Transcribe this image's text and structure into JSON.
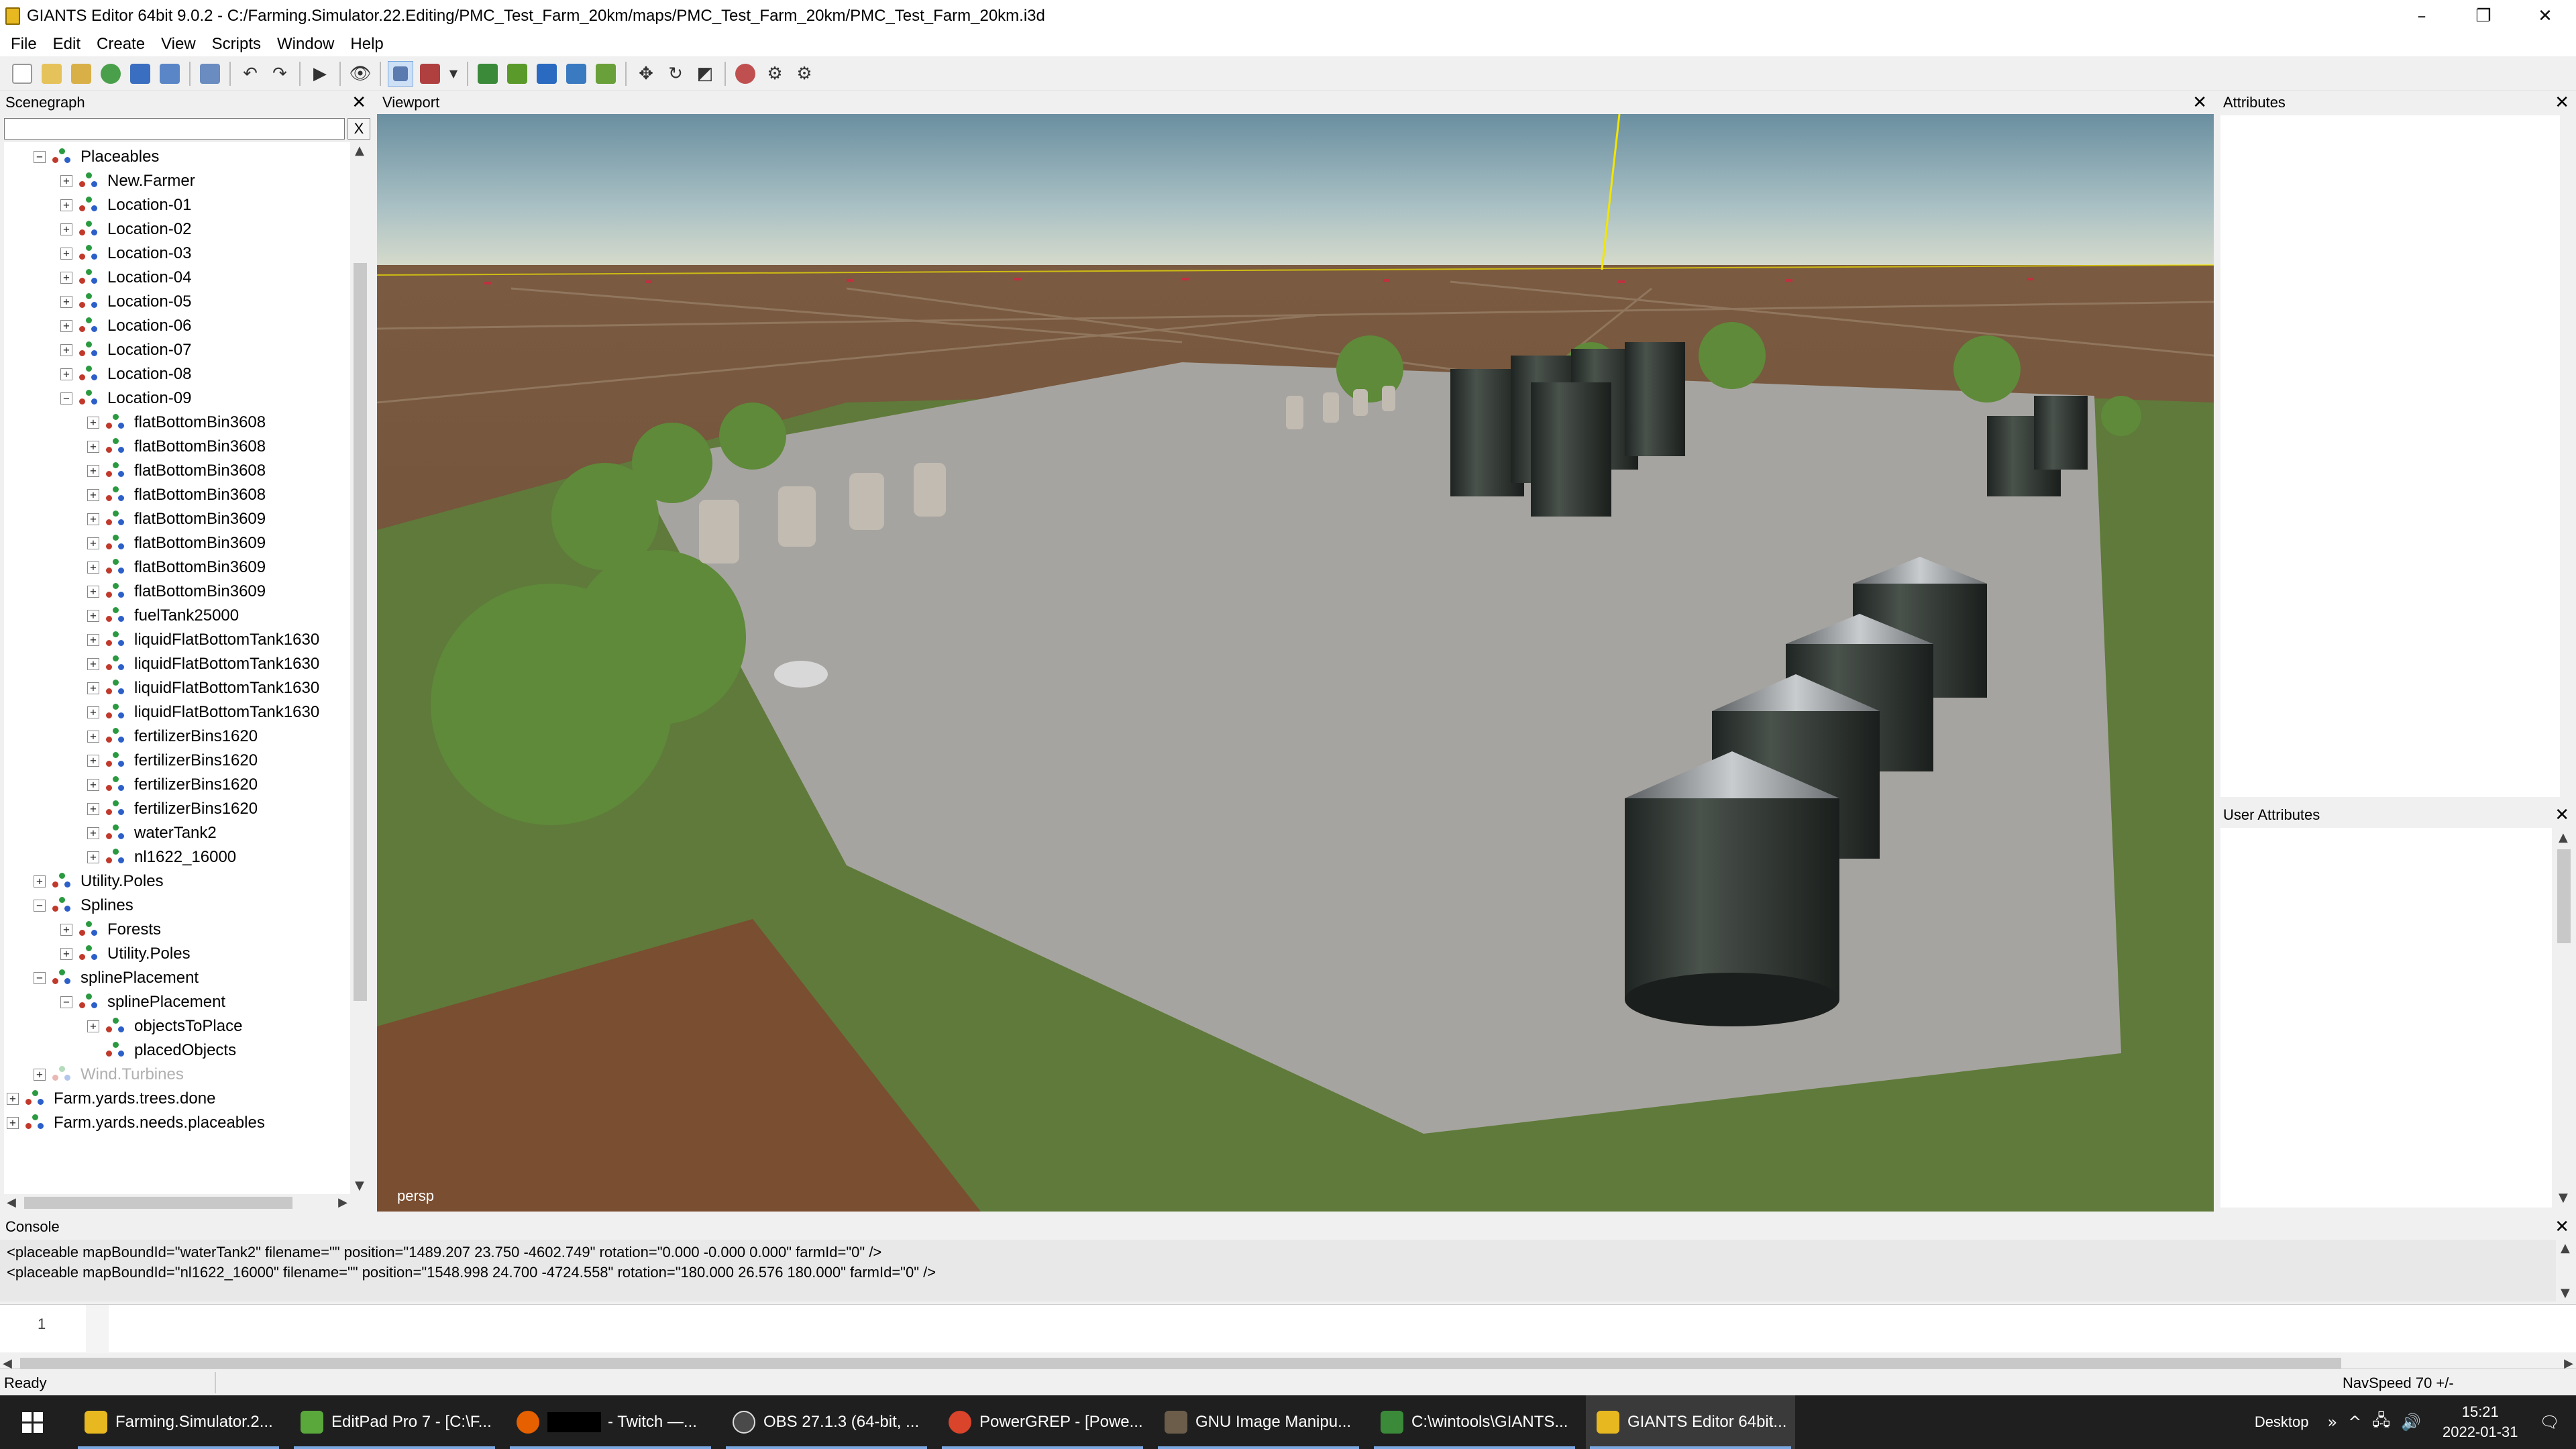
{
  "window": {
    "title": "GIANTS Editor 64bit 9.0.2 - C:/Farming.Simulator.22.Editing/PMC_Test_Farm_20km/maps/PMC_Test_Farm_20km/PMC_Test_Farm_20km.i3d",
    "minimize": "–",
    "restore": "❐",
    "close": "✕"
  },
  "menu": [
    "File",
    "Edit",
    "Create",
    "View",
    "Scripts",
    "Window",
    "Help"
  ],
  "panels": {
    "scenegraph": "Scenegraph",
    "viewport": "Viewport",
    "attributes": "Attributes",
    "user_attributes": "User Attributes",
    "console": "Console",
    "close_glyph": "✕"
  },
  "scenegraph": {
    "search_value": "",
    "clear_label": "X",
    "nodes": [
      {
        "label": "Placeables",
        "expanded": true,
        "dim": false
      },
      {
        "label": "New.Farmer",
        "expanded": false,
        "dim": false
      },
      {
        "label": "Location-01",
        "expanded": false,
        "dim": false
      },
      {
        "label": "Location-02",
        "expanded": false,
        "dim": false
      },
      {
        "label": "Location-03",
        "expanded": false,
        "dim": false
      },
      {
        "label": "Location-04",
        "expanded": false,
        "dim": false
      },
      {
        "label": "Location-05",
        "expanded": false,
        "dim": false
      },
      {
        "label": "Location-06",
        "expanded": false,
        "dim": false
      },
      {
        "label": "Location-07",
        "expanded": false,
        "dim": false
      },
      {
        "label": "Location-08",
        "expanded": false,
        "dim": false
      },
      {
        "label": "Location-09",
        "expanded": true,
        "dim": false
      },
      {
        "label": "flatBottomBin3608",
        "expanded": false,
        "dim": false
      },
      {
        "label": "flatBottomBin3608",
        "expanded": false,
        "dim": false
      },
      {
        "label": "flatBottomBin3608",
        "expanded": false,
        "dim": false
      },
      {
        "label": "flatBottomBin3608",
        "expanded": false,
        "dim": false
      },
      {
        "label": "flatBottomBin3609",
        "expanded": false,
        "dim": false
      },
      {
        "label": "flatBottomBin3609",
        "expanded": false,
        "dim": false
      },
      {
        "label": "flatBottomBin3609",
        "expanded": false,
        "dim": false
      },
      {
        "label": "flatBottomBin3609",
        "expanded": false,
        "dim": false
      },
      {
        "label": "fuelTank25000",
        "expanded": false,
        "dim": false
      },
      {
        "label": "liquidFlatBottomTank1630",
        "expanded": false,
        "dim": false
      },
      {
        "label": "liquidFlatBottomTank1630",
        "expanded": false,
        "dim": false
      },
      {
        "label": "liquidFlatBottomTank1630",
        "expanded": false,
        "dim": false
      },
      {
        "label": "liquidFlatBottomTank1630",
        "expanded": false,
        "dim": false
      },
      {
        "label": "fertilizerBins1620",
        "expanded": false,
        "dim": false
      },
      {
        "label": "fertilizerBins1620",
        "expanded": false,
        "dim": false
      },
      {
        "label": "fertilizerBins1620",
        "expanded": false,
        "dim": false
      },
      {
        "label": "fertilizerBins1620",
        "expanded": false,
        "dim": false
      },
      {
        "label": "waterTank2",
        "expanded": false,
        "dim": false
      },
      {
        "label": "nl1622_16000",
        "expanded": false,
        "dim": false
      },
      {
        "label": "Utility.Poles",
        "expanded": false,
        "dim": false
      },
      {
        "label": "Splines",
        "expanded": true,
        "dim": false
      },
      {
        "label": "Forests",
        "expanded": false,
        "dim": false
      },
      {
        "label": "Utility.Poles",
        "expanded": false,
        "dim": false
      },
      {
        "label": "splinePlacement",
        "expanded": true,
        "dim": false
      },
      {
        "label": "splinePlacement",
        "expanded": true,
        "dim": false
      },
      {
        "label": "objectsToPlace",
        "expanded": false,
        "dim": false
      },
      {
        "label": "placedObjects",
        "expanded": null,
        "dim": false
      },
      {
        "label": "Wind.Turbines",
        "expanded": false,
        "dim": true
      },
      {
        "label": "Farm.yards.trees.done",
        "expanded": false,
        "dim": false
      },
      {
        "label": "Farm.yards.needs.placeables",
        "expanded": false,
        "dim": false
      }
    ]
  },
  "viewport": {
    "camera": "persp"
  },
  "console": {
    "lines": [
      "<placeable mapBoundId=\"waterTank2\" filename=\"\" position=\"1489.207 23.750 -4602.749\" rotation=\"0.000 -0.000 0.000\" farmId=\"0\" />",
      "<placeable mapBoundId=\"nl1622_16000\" filename=\"\" position=\"1548.998 24.700 -4724.558\" rotation=\"180.000 26.576 180.000\" farmId=\"0\" />"
    ],
    "line_number": "1",
    "input_value": ""
  },
  "status": {
    "left": "Ready",
    "right": "NavSpeed 70 +/-"
  },
  "taskbar": {
    "tasks": [
      {
        "label": "Farming.Simulator.2...",
        "color": "#e8b820"
      },
      {
        "label": "EditPad Pro 7 - [C:\\F...",
        "color": "#5aa83c"
      },
      {
        "label": "- Twitch —...",
        "color": "#e66000"
      },
      {
        "label": "OBS 27.1.3 (64-bit, ...",
        "color": "#4a4a4a"
      },
      {
        "label": "PowerGREP - [Powe...",
        "color": "#d9442a"
      },
      {
        "label": "GNU Image Manipu...",
        "color": "#6b5d4a"
      },
      {
        "label": "C:\\wintools\\GIANTS...",
        "color": "#3a8a3a"
      },
      {
        "label": "GIANTS Editor 64bit...",
        "color": "#e8b820"
      }
    ],
    "desktop_label": "Desktop",
    "overflow": "»",
    "time": "15:21",
    "date": "2022-01-31"
  },
  "toolbar_icons": [
    "new-file",
    "open-folder",
    "open-recent",
    "reload",
    "save",
    "save-as",
    "export",
    "undo",
    "redo",
    "play",
    "visibility",
    "select-mode",
    "terrain-paint",
    "dropdown",
    "tree-place",
    "foliage",
    "object-place",
    "vertex",
    "spline",
    "move",
    "rotate",
    "scale",
    "shader-ball",
    "settings-gear",
    "options-gear"
  ]
}
